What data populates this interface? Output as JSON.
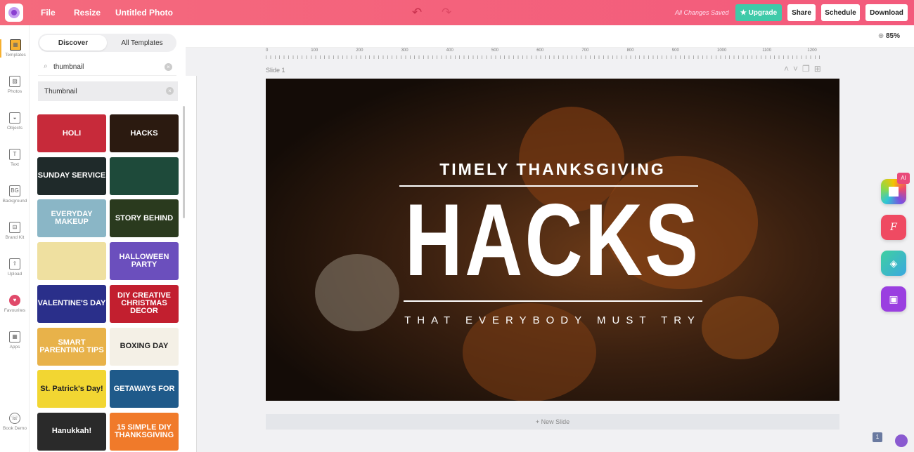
{
  "topbar": {
    "file": "File",
    "resize": "Resize",
    "title": "Untitled Photo",
    "status": "All Changes Saved",
    "upgrade": "Upgrade",
    "share": "Share",
    "schedule": "Schedule",
    "download": "Download"
  },
  "rail": [
    {
      "label": "Templates",
      "icon": "▦"
    },
    {
      "label": "Photos",
      "icon": "▨"
    },
    {
      "label": "Objects",
      "icon": "◒"
    },
    {
      "label": "Text",
      "icon": "T"
    },
    {
      "label": "Background",
      "icon": "BG"
    },
    {
      "label": "Brand Kit",
      "icon": "⊟"
    },
    {
      "label": "Upload",
      "icon": "⇧"
    },
    {
      "label": "Favourites",
      "icon": "♥"
    },
    {
      "label": "Apps",
      "icon": "▦"
    },
    {
      "label": "Book Demo",
      "icon": "☏"
    }
  ],
  "panel": {
    "tabs": [
      "Discover",
      "All Templates"
    ],
    "search_value": "thumbnail",
    "chip": "Thumbnail",
    "templates": [
      {
        "text": "HOLI",
        "bg": "#c72a3a"
      },
      {
        "text": "HACKS",
        "bg": "#2b1a10"
      },
      {
        "text": "SUNDAY SERVICE",
        "bg": "#1f2a2a"
      },
      {
        "text": "",
        "bg": "#1e4a3a"
      },
      {
        "text": "EVERYDAY MAKEUP",
        "bg": "#8ab6c6"
      },
      {
        "text": "STORY BEHIND",
        "bg": "#2a3a1e"
      },
      {
        "text": "",
        "bg": "#efe0a0"
      },
      {
        "text": "HALLOWEEN PARTY",
        "bg": "#6b4fbd"
      },
      {
        "text": "VALENTINE'S DAY",
        "bg": "#2a2f8a"
      },
      {
        "text": "DIY CREATIVE CHRISTMAS DECOR",
        "bg": "#c21f2f"
      },
      {
        "text": "SMART PARENTING TIPS",
        "bg": "#e8b24a"
      },
      {
        "text": "BOXING DAY",
        "bg": "#f4f0e6"
      },
      {
        "text": "St. Patrick's Day!",
        "bg": "#f2d632"
      },
      {
        "text": "GETAWAYS FOR",
        "bg": "#1f5a8a"
      },
      {
        "text": "Hanukkah!",
        "bg": "#2a2a2a"
      },
      {
        "text": "15 SIMPLE DIY THANKSGIVING",
        "bg": "#f07a2a"
      }
    ]
  },
  "canvas": {
    "zoom": "85%",
    "slide_label": "Slide 1",
    "ruler": [
      "0",
      "100",
      "200",
      "300",
      "400",
      "500",
      "600",
      "700",
      "800",
      "900",
      "1000",
      "1100",
      "1200"
    ],
    "new_slide": "+ New Slide",
    "page_number": "1"
  },
  "slide": {
    "line1": "TIMELY THANKSGIVING",
    "line2": "HACKS",
    "line3": "THAT EVERYBODY MUST TRY"
  },
  "side_tools": {
    "ai_badge": "AI"
  },
  "colors": {
    "topbar": "#f35a7c",
    "upgrade": "#3fcaa9"
  }
}
